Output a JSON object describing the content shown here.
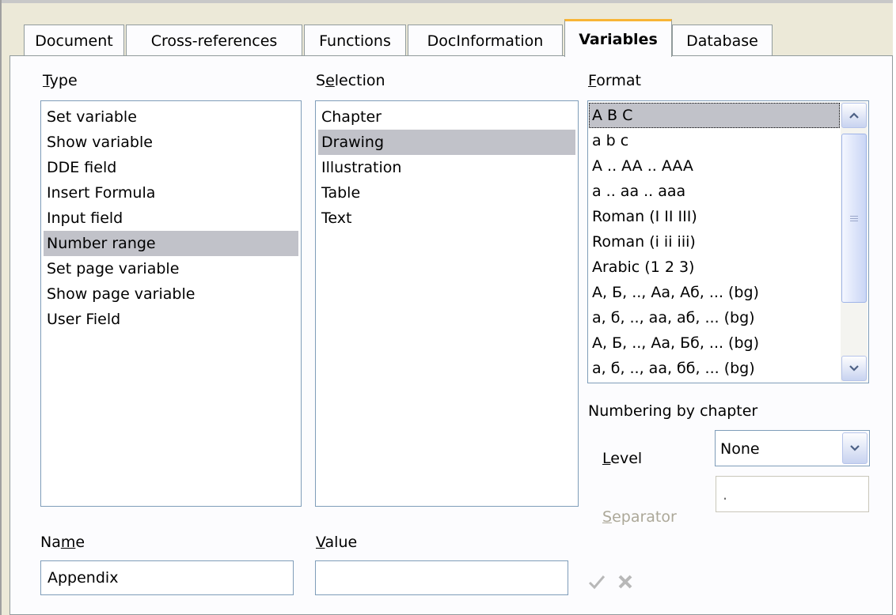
{
  "tabs": [
    {
      "label": "Document"
    },
    {
      "label": "Cross-references"
    },
    {
      "label": "Functions"
    },
    {
      "label": "DocInformation"
    },
    {
      "label": "Variables"
    },
    {
      "label": "Database"
    }
  ],
  "type": {
    "label_pre": "",
    "label_mnemonic": "T",
    "label_post": "ype",
    "items": [
      "Set variable",
      "Show variable",
      "DDE field",
      "Insert Formula",
      "Input field",
      "Number range",
      "Set page variable",
      "Show page variable",
      "User Field"
    ],
    "selected": "Number range"
  },
  "selection": {
    "label_pre": "S",
    "label_mnemonic": "e",
    "label_post": "lection",
    "items": [
      "Chapter",
      "Drawing",
      "Illustration",
      "Table",
      "Text"
    ],
    "selected": "Drawing"
  },
  "format": {
    "label_pre": "",
    "label_mnemonic": "F",
    "label_post": "ormat",
    "items": [
      "A B C",
      "a b c",
      "A .. AA .. AAA",
      "a .. aa .. aaa",
      "Roman (I II III)",
      "Roman (i ii iii)",
      "Arabic (1 2 3)",
      "А, Б, .., Аа, Аб, ... (bg)",
      "а, б, .., аа, аб, ... (bg)",
      "А, Б, .., Аа, Бб, ... (bg)",
      "а, б, .., аа, бб, ... (bg)"
    ],
    "selected": "A B C"
  },
  "numbering": {
    "heading": "Numbering by chapter",
    "level_pre": "",
    "level_mnemonic": "L",
    "level_post": "evel",
    "level_value": "None",
    "separator_pre": "",
    "separator_mnemonic": "S",
    "separator_post": "eparator",
    "separator_value": "."
  },
  "name": {
    "label_pre": "Na",
    "label_mnemonic": "m",
    "label_post": "e",
    "value": "Appendix"
  },
  "value": {
    "label_pre": "",
    "label_mnemonic": "V",
    "label_post": "alue",
    "value": ""
  },
  "colors": {
    "active_tab_accent": "#f8b536",
    "selection": "#c1c2c9",
    "field_border": "#7f9db9"
  },
  "icons": {
    "apply": "checkmark-icon",
    "delete": "x-icon"
  }
}
